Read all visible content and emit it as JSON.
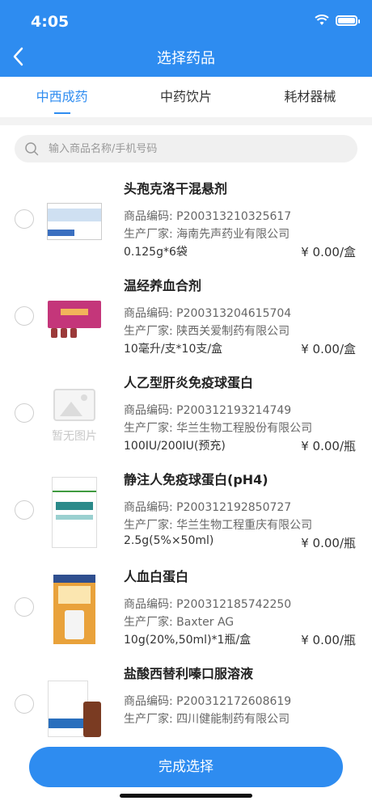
{
  "status": {
    "time": "4:05"
  },
  "nav": {
    "title": "选择药品"
  },
  "tabs": [
    {
      "label": "中西成药",
      "active": true
    },
    {
      "label": "中药饮片",
      "active": false
    },
    {
      "label": "耗材器械",
      "active": false
    }
  ],
  "search": {
    "placeholder": "输入商品名称/手机号码",
    "value": ""
  },
  "products": [
    {
      "name": "头孢克洛干混悬剂",
      "code": "商品编码: P200313210325617",
      "maker": "生产厂家: 海南先声药业有限公司",
      "spec": "0.125g*6袋",
      "price": "¥ 0.00/盒"
    },
    {
      "name": "温经养血合剂",
      "code": "商品编码: P200313204615704",
      "maker": "生产厂家: 陕西关爱制药有限公司",
      "spec": "10毫升/支*10支/盒",
      "price": "¥ 0.00/盒"
    },
    {
      "name": "人乙型肝炎免疫球蛋白",
      "code": "商品编码: P200312193214749",
      "maker": "生产厂家: 华兰生物工程股份有限公司",
      "spec": "100IU/200IU(预充)",
      "price": "¥ 0.00/瓶",
      "no_image_text": "暂无图片"
    },
    {
      "name": "静注人免疫球蛋白(pH4)",
      "code": "商品编码: P200312192850727",
      "maker": "生产厂家: 华兰生物工程重庆有限公司",
      "spec": "2.5g(5%×50ml)",
      "price": "¥ 0.00/瓶"
    },
    {
      "name": "人血白蛋白",
      "code": "商品编码: P200312185742250",
      "maker": "生产厂家: Baxter AG",
      "spec": "10g(20%,50ml)*1瓶/盒",
      "price": "¥ 0.00/瓶"
    },
    {
      "name": "盐酸西替利嗪口服溶液",
      "code": "商品编码: P200312172608619",
      "maker": "生产厂家: 四川健能制药有限公司",
      "spec": "",
      "price": ""
    }
  ],
  "footer": {
    "done_label": "完成选择"
  },
  "colors": {
    "primary": "#2e8cf0"
  }
}
